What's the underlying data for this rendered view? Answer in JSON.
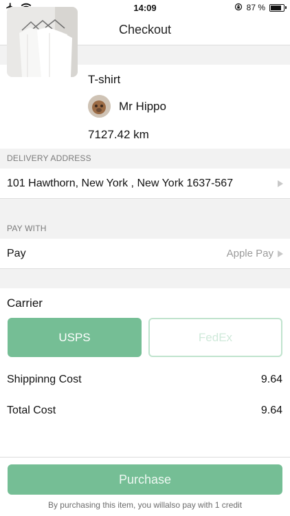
{
  "status_bar": {
    "time": "14:09",
    "battery_text": "87 %",
    "battery_level": 0.87,
    "icons": [
      "airplane-icon",
      "wifi-icon",
      "rotation-lock-icon",
      "battery-icon"
    ]
  },
  "nav": {
    "title": "Checkout",
    "back_icon": "back-arrow-icon"
  },
  "product": {
    "title": "T-shirt",
    "seller_name": "Mr Hippo",
    "distance": "7127.42 km"
  },
  "delivery": {
    "header": "DELIVERY ADDRESS",
    "address": "101 Hawthorn, New York , New York 1637-567"
  },
  "payment": {
    "header": "PAY WITH",
    "label": "Pay",
    "method": "Apple Pay"
  },
  "carrier": {
    "label": "Carrier",
    "options": [
      "USPS",
      "FedEx"
    ],
    "selected": "USPS"
  },
  "costs": {
    "shipping_label": "Shippinng Cost",
    "shipping_value": "9.64",
    "total_label": "Total Cost",
    "total_value": "9.64"
  },
  "purchase": {
    "button_label": "Purchase",
    "note": "By purchasing this item, you willalso pay with 1 credit"
  },
  "colors": {
    "accent": "#75be95",
    "accent_light": "#bfe3cd",
    "background": "#f2f2f2"
  }
}
